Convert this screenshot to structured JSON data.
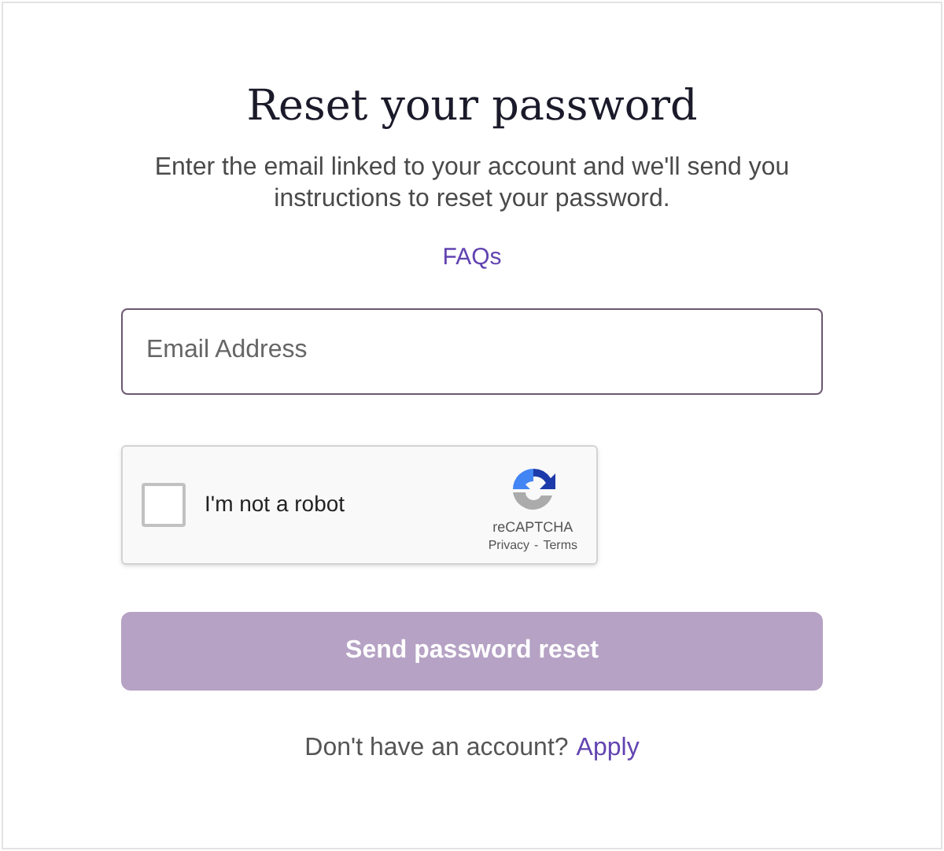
{
  "title": "Reset your password",
  "description": "Enter the email linked to your account and we'll send you instructions to reset your password.",
  "faq_link": "FAQs",
  "email_field": {
    "placeholder": "Email Address"
  },
  "recaptcha": {
    "label": "I'm not a robot",
    "checked": false,
    "brand": "reCAPTCHA",
    "privacy": "Privacy",
    "separator": "-",
    "terms": "Terms"
  },
  "submit_button": {
    "label": "Send password reset",
    "disabled": true
  },
  "footer": {
    "text": "Don't have an account?",
    "link": "Apply"
  }
}
